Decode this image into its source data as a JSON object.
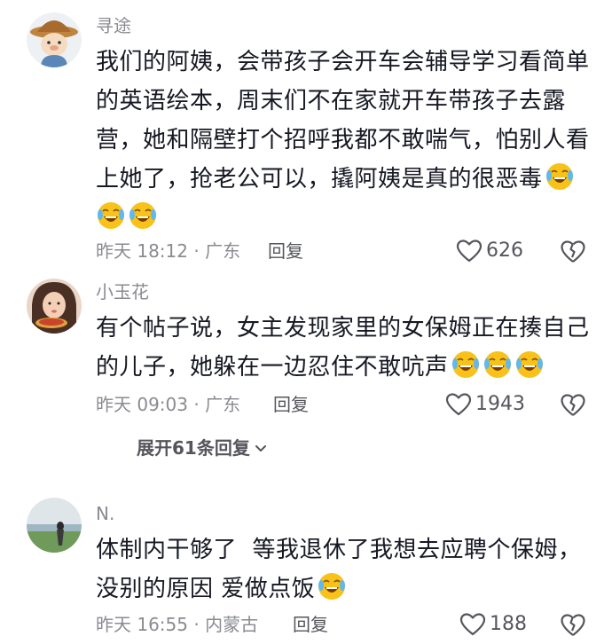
{
  "comments": [
    {
      "username": "寻途",
      "lines": [
        "我们的阿姨，会带孩子会开车会辅导学习看简单",
        "的英语绘本，周末们不在家就开车带孩子去露",
        "营，她和隔壁打个招呼我都不敢喘气，怕别人看",
        "上她了，抢老公可以，撬阿姨是真的很恶毒"
      ],
      "time_location": "昨天 18:12 · 广东",
      "reply_label": "回复",
      "likes": "626"
    },
    {
      "username": "小玉花",
      "lines": [
        "有个帖子说，女主发现家里的女保姆正在揍自己",
        "的儿子，她躲在一边忍住不敢吭声"
      ],
      "time_location": "昨天 09:03 · 广东",
      "reply_label": "回复",
      "likes": "1943",
      "expand_label": "展开61条回复"
    },
    {
      "username": "N.",
      "lines": [
        "体制内干够了  等我退休了我想去应聘个保姆，",
        "没别的原因 爱做点饭"
      ],
      "time_location": "昨天 16:55 · 内蒙古",
      "reply_label": "回复",
      "likes": "188"
    }
  ],
  "icons": {
    "like": "heart-outline-icon",
    "dislike": "broken-heart-icon",
    "emoji": "laughing-crying-emoji",
    "expand": "chevron-down-icon"
  },
  "colors": {
    "text": "#161823",
    "meta": "#8a8b91",
    "action": "#55565c"
  }
}
